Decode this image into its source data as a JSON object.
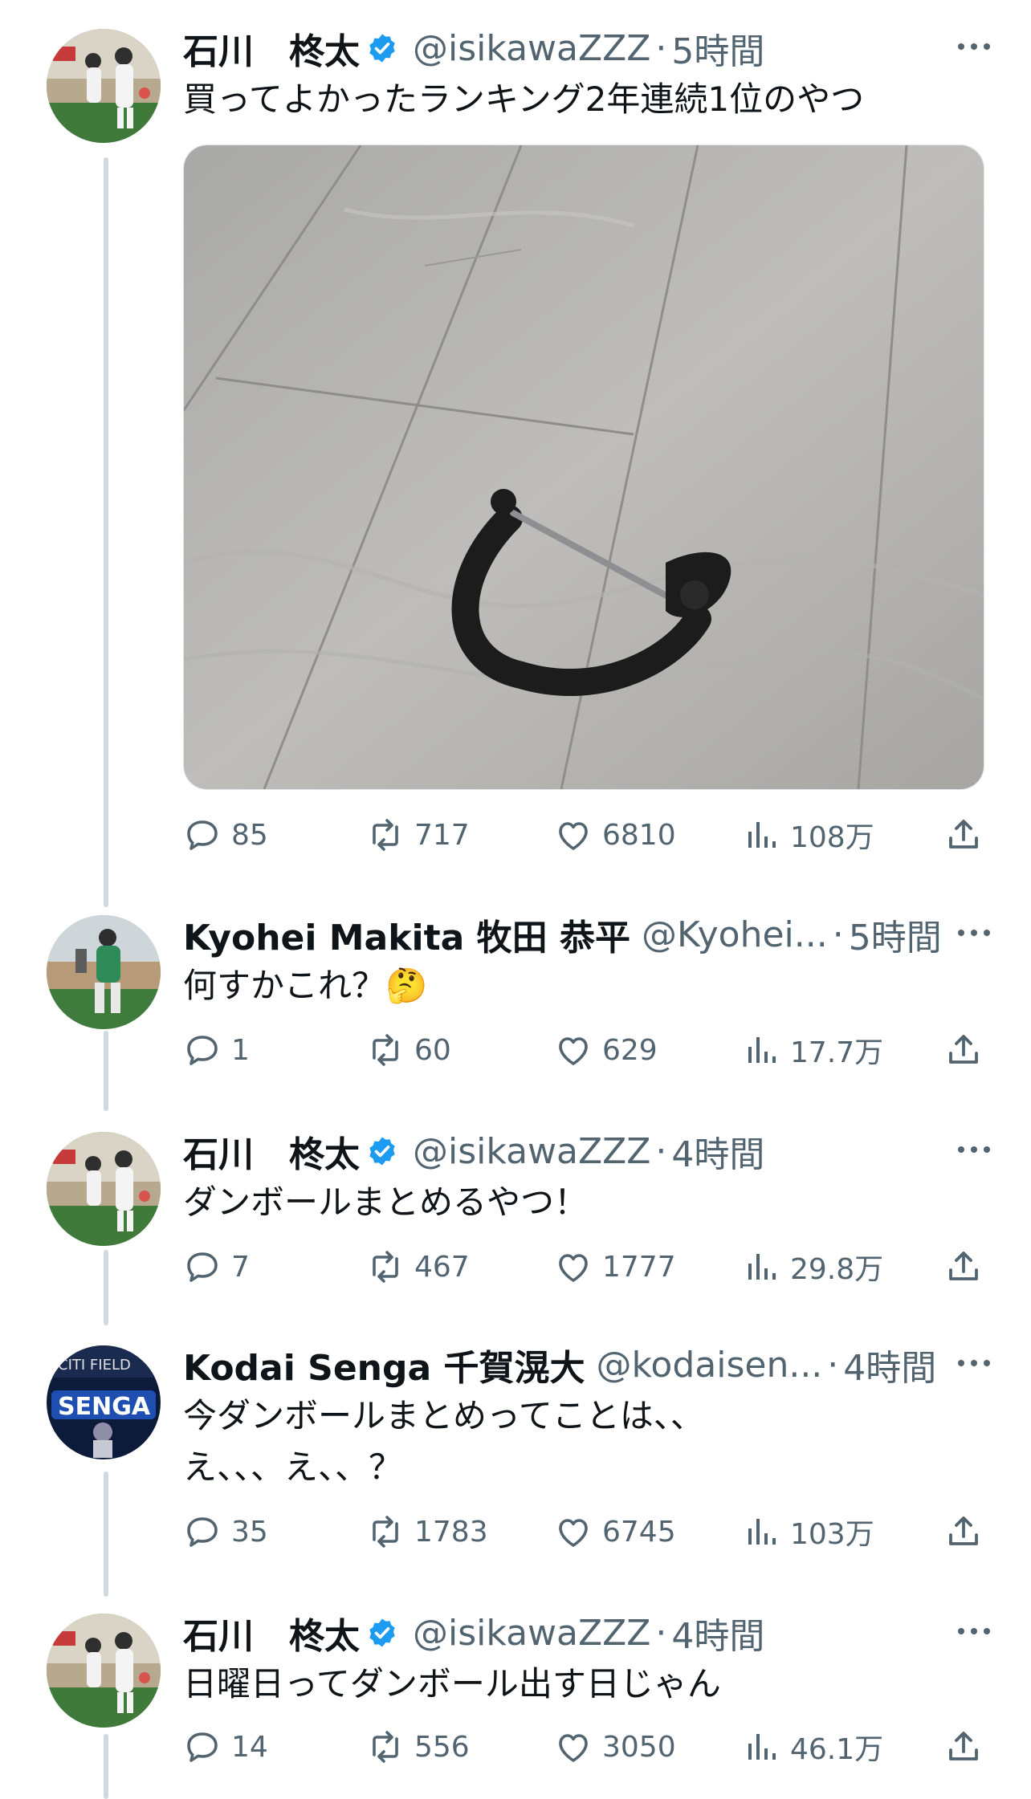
{
  "tweets": [
    {
      "display_name": "石川　柊太",
      "verified": true,
      "handle": "@isikawaZZZ",
      "time": "5時間",
      "text": "買ってよかったランキング2年連続1位のやつ",
      "has_media": true,
      "replies": "85",
      "retweets": "717",
      "likes": "6810",
      "views": "108万"
    },
    {
      "display_name": "Kyohei Makita 牧田 恭平",
      "verified": false,
      "handle": "@Kyohei...",
      "time": "5時間",
      "text": "何すかこれ？🤔",
      "replies": "1",
      "retweets": "60",
      "likes": "629",
      "views": "17.7万"
    },
    {
      "display_name": "石川　柊太",
      "verified": true,
      "handle": "@isikawaZZZ",
      "time": "4時間",
      "text": "ダンボールまとめるやつ！",
      "replies": "7",
      "retweets": "467",
      "likes": "1777",
      "views": "29.8万"
    },
    {
      "display_name": "Kodai Senga 千賀滉大",
      "verified": false,
      "handle": "@kodaisen...",
      "time": "4時間",
      "text": "今ダンボールまとめってことは、、\nえ、、、え、、？",
      "replies": "35",
      "retweets": "1783",
      "likes": "6745",
      "views": "103万"
    },
    {
      "display_name": "石川　柊太",
      "verified": true,
      "handle": "@isikawaZZZ",
      "time": "4時間",
      "text": "日曜日ってダンボール出す日じゃん",
      "replies": "14",
      "retweets": "556",
      "likes": "3050",
      "views": "46.1万"
    }
  ],
  "separator": "·",
  "colors": {
    "verified": "#1d9bf0",
    "secondary_text": "#536471",
    "thread_line": "#cfd9de"
  },
  "icons": {
    "reply": "reply-icon",
    "retweet": "retweet-icon",
    "like": "like-icon",
    "views": "views-icon",
    "share": "share-icon",
    "more": "more-icon",
    "verified": "verified-badge-icon"
  }
}
